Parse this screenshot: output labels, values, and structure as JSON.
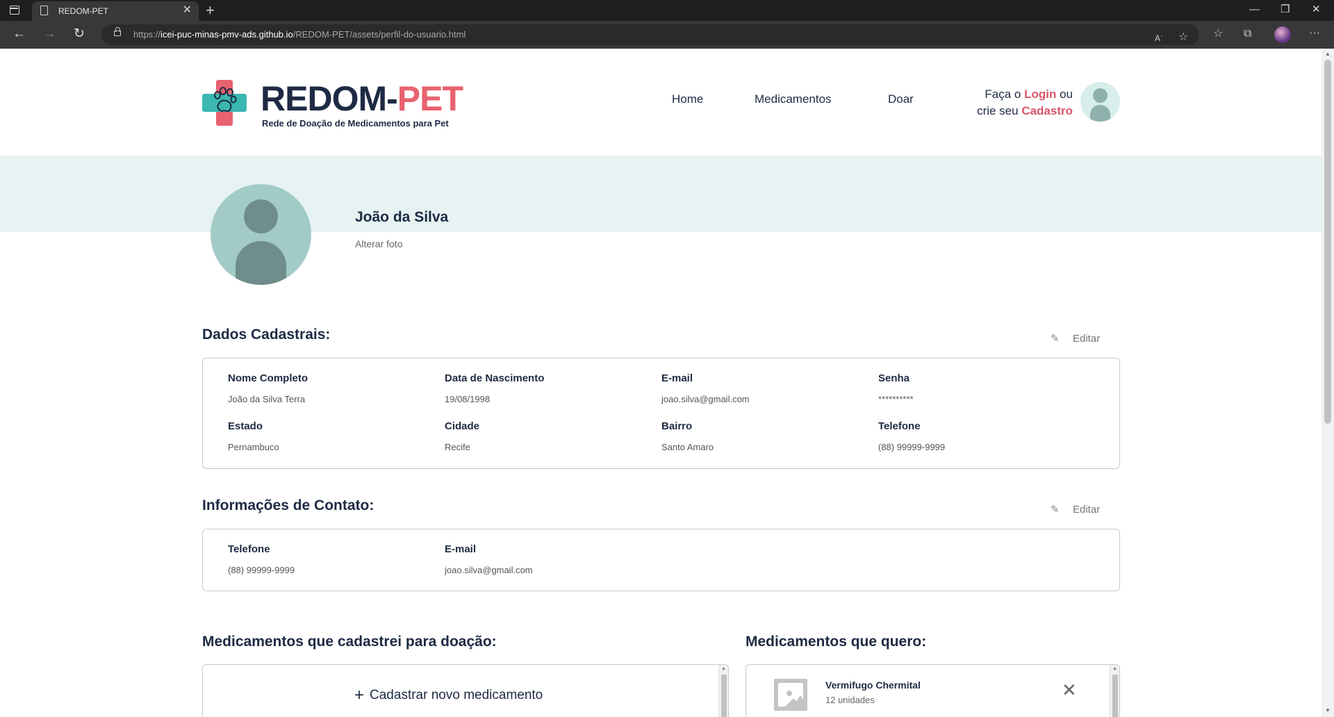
{
  "browser": {
    "tab_title": "REDOM-PET",
    "tab_close": "✕",
    "new_tab": "+",
    "url_prefix": "https://",
    "url_host": "icei-puc-minas-pmv-ads.github.io",
    "url_path": "/REDOM-PET/assets/perfil-do-usuario.html",
    "minimize": "—",
    "restore": "❐",
    "close": "✕",
    "back": "←",
    "forward": "→",
    "reload": "↻",
    "read_aloud": "Aʾ",
    "add_favorite": "☆",
    "favorites": "☆",
    "collections": "⧉",
    "more": "···"
  },
  "header": {
    "logo_main": "REDOM-",
    "logo_accent": "PET",
    "logo_subtitle": "Rede de Doação de Medicamentos para Pet",
    "nav": [
      "Home",
      "Medicamentos",
      "Doar"
    ],
    "login_prefix": "Faça o ",
    "login_link": "Login",
    "login_mid": " ou",
    "signup_prefix": "crie seu ",
    "signup_link": "Cadastro"
  },
  "profile": {
    "name": "João da Silva",
    "change_photo": "Alterar foto"
  },
  "registration": {
    "title": "Dados Cadastrais:",
    "edit_label": "Editar",
    "fields": [
      {
        "label": "Nome Completo",
        "value": "João da Silva Terra"
      },
      {
        "label": "Data de Nascimento",
        "value": "19/08/1998"
      },
      {
        "label": "E-mail",
        "value": "joao.silva@gmail.com"
      },
      {
        "label": "Senha",
        "value": "**********"
      },
      {
        "label": "Estado",
        "value": "Pernambuco"
      },
      {
        "label": "Cidade",
        "value": "Recife"
      },
      {
        "label": "Bairro",
        "value": "Santo Amaro"
      },
      {
        "label": "Telefone",
        "value": "(88) 99999-9999"
      }
    ]
  },
  "contact": {
    "title": "Informações de Contato:",
    "edit_label": "Editar",
    "fields": [
      {
        "label": "Telefone",
        "value": "(88) 99999-9999"
      },
      {
        "label": "E-mail",
        "value": "joao.silva@gmail.com"
      }
    ]
  },
  "donations": {
    "title": "Medicamentos que cadastrei para doação:",
    "add_label": "Cadastrar novo medicamento"
  },
  "wanted": {
    "title": "Medicamentos que quero:",
    "items": [
      {
        "name": "Vermifugo Chermital",
        "quantity": "12 unidades"
      }
    ]
  }
}
